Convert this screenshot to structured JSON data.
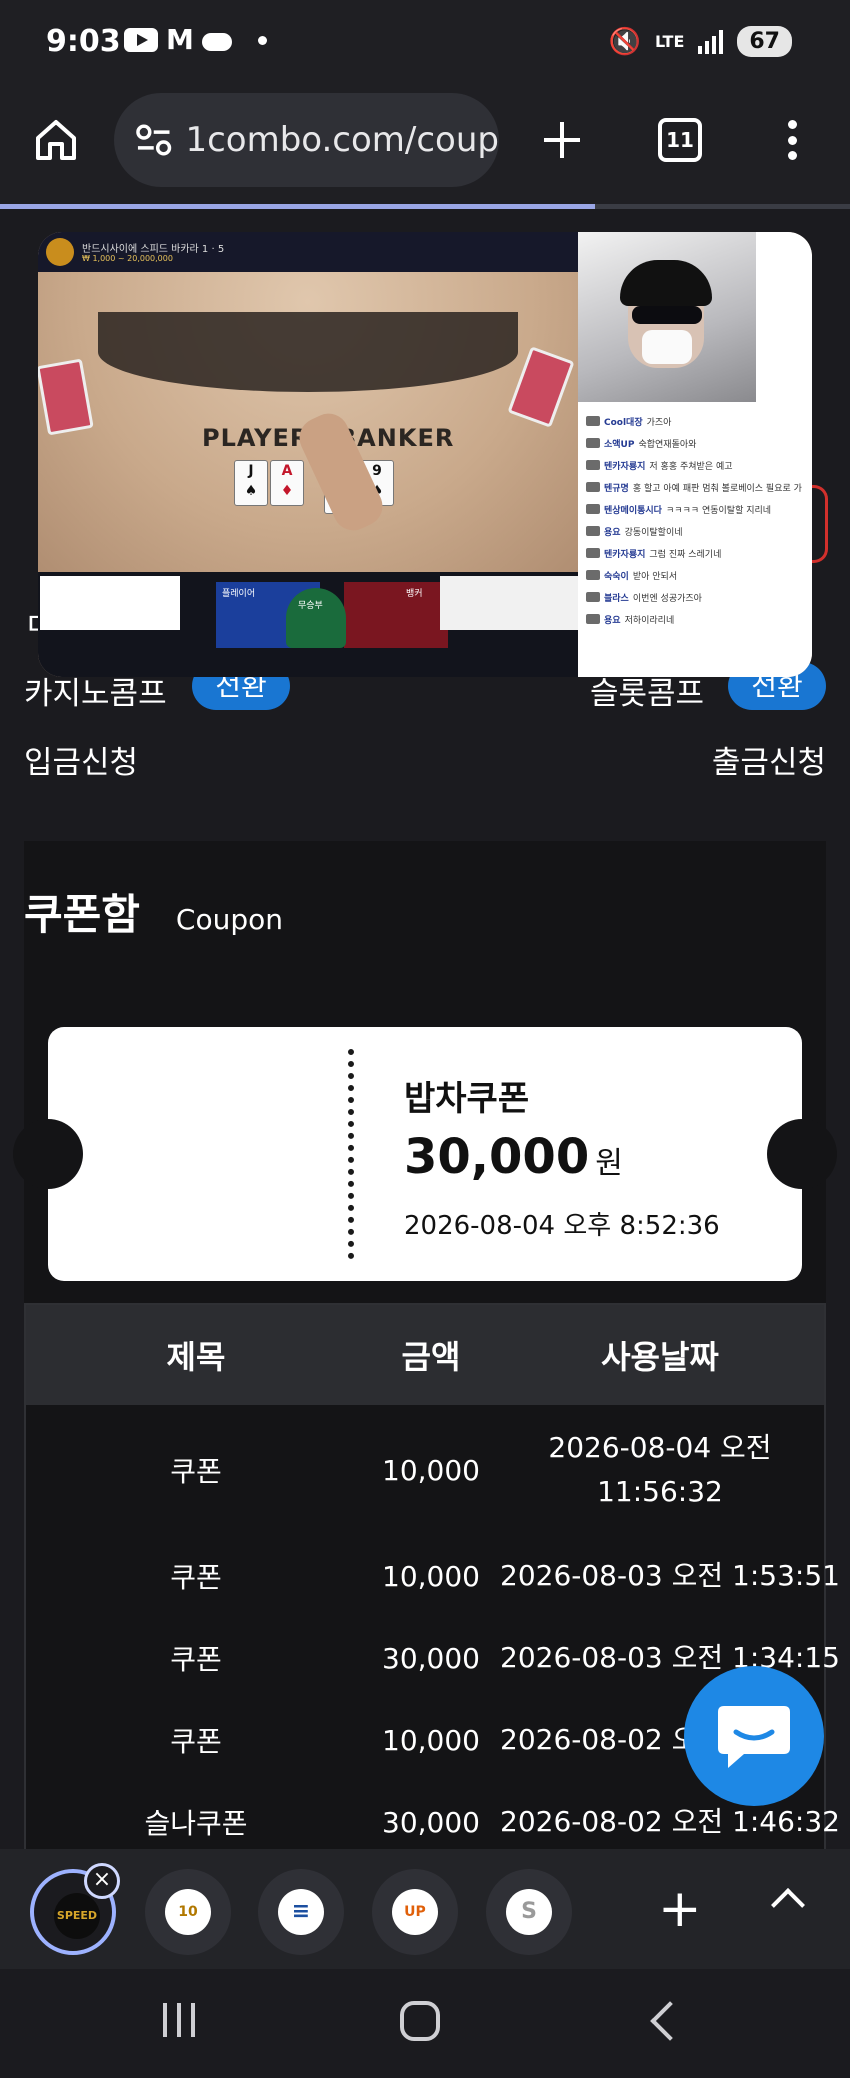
{
  "status_bar": {
    "time": "9:03",
    "network": "LTE",
    "battery": "67"
  },
  "browser": {
    "url": "1combo.com/coup",
    "tab_count": "11"
  },
  "video_overlay": {
    "title": "반드시사이에 스피드 바카라 1 · 5",
    "subtitle": "₩ 1,000 ~ 20,000,000",
    "table_text": "PLAYER | BANKER",
    "player_label": "플레이어",
    "tie_label": "무승부",
    "banker_label": "뱅커",
    "chat": [
      {
        "user": "Cool대장",
        "msg": "가즈아"
      },
      {
        "user": "소액UP",
        "msg": "숙합연재돌아와"
      },
      {
        "user": "텐카자룡지",
        "msg": "저 홍홍 주쳐받은 예고"
      },
      {
        "user": "텐규명",
        "msg": "홍 할고 아예 패판 멈춰 볼로베이스 필요로 가"
      },
      {
        "user": "텐상메이통시다",
        "msg": "ㅋㅋㅋㅋ 연동이탈할 지리네"
      },
      {
        "user": "용요",
        "msg": "강동이탈할이네"
      },
      {
        "user": "텐카자룡지",
        "msg": "그럼 진짜 스레기네"
      },
      {
        "user": "숙숙이",
        "msg": "받아 안되서"
      },
      {
        "user": "블라스",
        "msg": "이번엔 성공가즈아"
      },
      {
        "user": "용요",
        "msg": "저하이라리네"
      }
    ]
  },
  "comp": {
    "casino_label": "카지노콤프",
    "slot_label": "슬롯콤프",
    "switch_label": "전환",
    "left_fragment": "ㅁ"
  },
  "requests": {
    "deposit": "입금신청",
    "withdraw": "출금신청"
  },
  "coupon_box": {
    "title": "쿠폰함",
    "subtitle": "Coupon",
    "ticket": {
      "name": "밥차쿠폰",
      "amount": "30,000",
      "unit": "원",
      "date": "2026-08-04 오후 8:52:36"
    },
    "columns": [
      "제목",
      "금액",
      "사용날짜"
    ],
    "rows": [
      {
        "title": "쿠폰",
        "amount": "10,000",
        "date": "2026-08-04 오전 11:56:32"
      },
      {
        "title": "쿠폰",
        "amount": "10,000",
        "date": "2026-08-03 오전 1:53:51"
      },
      {
        "title": "쿠폰",
        "amount": "30,000",
        "date": "2026-08-03 오전 1:34:15"
      },
      {
        "title": "쿠폰",
        "amount": "10,000",
        "date": "2026-08-02 오"
      },
      {
        "title": "슬나쿠폰",
        "amount": "30,000",
        "date": "2026-08-02 오전 1:46:32"
      }
    ]
  },
  "shortcuts": {
    "items": [
      "SPEED",
      "10",
      "≡",
      "UP",
      "S"
    ]
  },
  "icons": {
    "home": "home-icon",
    "site_settings": "site-settings-icon",
    "new_tab": "plus-icon",
    "more": "more-vertical-icon",
    "chat": "chat-bubble-icon"
  },
  "colors": {
    "accent_blue": "#1976d2",
    "fab_blue": "#1e88e5",
    "background": "#1b1b1f",
    "ticket_bg": "#ffffff"
  },
  "progress": 0.7
}
